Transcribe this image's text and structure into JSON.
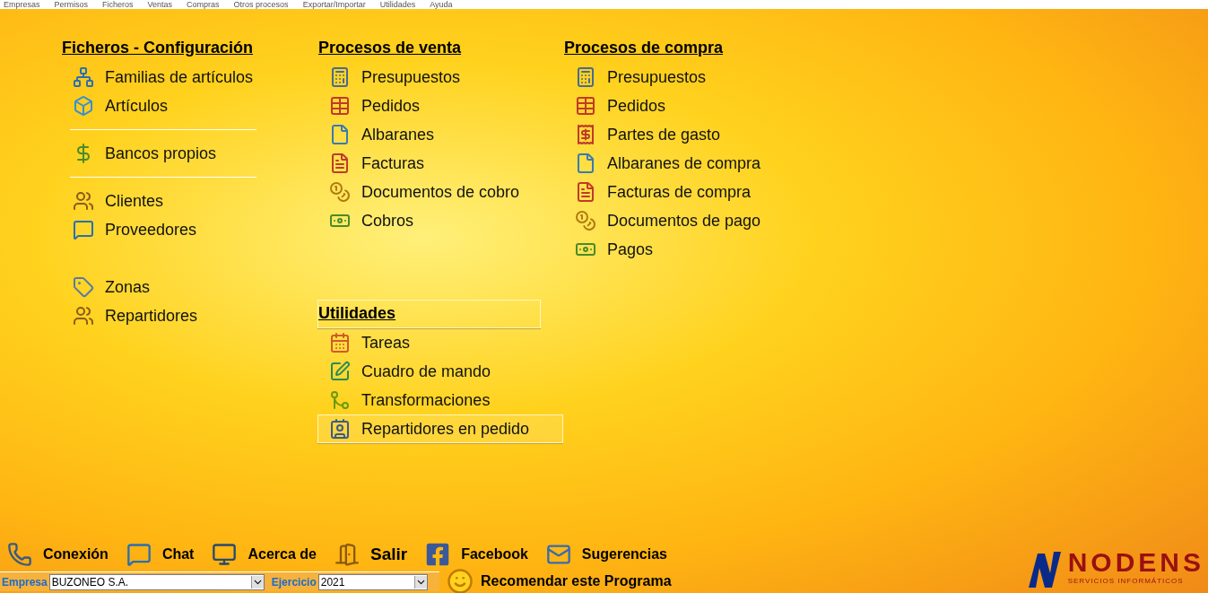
{
  "menu_bar": [
    "Empresas",
    "Permisos",
    "Ficheros",
    "Ventas",
    "Compras",
    "Otros procesos",
    "Exportar/Importar",
    "Utilidades",
    "Ayuda"
  ],
  "columns": [
    {
      "sections": [
        {
          "title": "Ficheros - Configuración",
          "highlighted": false,
          "groups": [
            {
              "kind": "plain",
              "items": [
                {
                  "label": "Familias de artículos",
                  "kind": "tree",
                  "hovered": false
                },
                {
                  "label": "Artículos",
                  "kind": "box",
                  "hovered": false
                }
              ]
            },
            {
              "kind": "divided",
              "items": [
                {
                  "label": "Bancos propios",
                  "kind": "dollar",
                  "hovered": false
                }
              ]
            },
            {
              "kind": "divided",
              "items": [
                {
                  "label": "Clientes",
                  "kind": "people",
                  "hovered": false
                },
                {
                  "label": "Proveedores",
                  "kind": "chat",
                  "hovered": false
                }
              ]
            },
            {
              "kind": "spaced",
              "items": [
                {
                  "label": "Zonas",
                  "kind": "tag",
                  "hovered": false
                },
                {
                  "label": "Repartidores",
                  "kind": "people",
                  "hovered": false
                }
              ]
            }
          ]
        }
      ]
    },
    {
      "sections": [
        {
          "title": "Procesos de venta",
          "highlighted": false,
          "groups": [
            {
              "kind": "plain",
              "items": [
                {
                  "label": "Presupuestos",
                  "kind": "calc",
                  "hovered": false
                },
                {
                  "label": "Pedidos",
                  "kind": "table",
                  "hovered": false
                },
                {
                  "label": "Albaranes",
                  "kind": "doc",
                  "hovered": false
                },
                {
                  "label": "Facturas",
                  "kind": "invoice",
                  "hovered": false
                },
                {
                  "label": "Documentos de cobro",
                  "kind": "coins",
                  "hovered": false
                },
                {
                  "label": "Cobros",
                  "kind": "cash",
                  "hovered": false
                }
              ]
            }
          ]
        },
        {
          "title": "Utilidades",
          "highlighted": true,
          "groups": [
            {
              "kind": "plain",
              "items": [
                {
                  "label": "Tareas",
                  "kind": "calendar",
                  "hovered": false
                },
                {
                  "label": "Cuadro de mando",
                  "kind": "edit",
                  "hovered": false
                },
                {
                  "label": "Transformaciones",
                  "kind": "merge",
                  "hovered": false
                },
                {
                  "label": "Repartidores en pedido",
                  "kind": "card",
                  "hovered": true
                }
              ]
            }
          ]
        }
      ]
    },
    {
      "sections": [
        {
          "title": "Procesos de compra",
          "highlighted": false,
          "groups": [
            {
              "kind": "plain",
              "items": [
                {
                  "label": "Presupuestos",
                  "kind": "calc",
                  "hovered": false
                },
                {
                  "label": "Pedidos",
                  "kind": "table",
                  "hovered": false
                },
                {
                  "label": "Partes de gasto",
                  "kind": "receipt",
                  "hovered": false
                },
                {
                  "label": "Albaranes de compra",
                  "kind": "doc",
                  "hovered": false
                },
                {
                  "label": "Facturas de compra",
                  "kind": "invoice",
                  "hovered": false
                },
                {
                  "label": "Documentos de pago",
                  "kind": "coins",
                  "hovered": false
                },
                {
                  "label": "Pagos",
                  "kind": "cash",
                  "hovered": false
                }
              ]
            }
          ]
        }
      ]
    }
  ],
  "toolbar": [
    {
      "label": "Conexión",
      "kind": "phone",
      "emphasis": false
    },
    {
      "label": "Chat",
      "kind": "chat",
      "emphasis": false
    },
    {
      "label": "Acerca de",
      "kind": "monitor",
      "emphasis": false
    },
    {
      "label": "Salir",
      "kind": "door",
      "emphasis": true
    },
    {
      "label": "Facebook",
      "kind": "facebook",
      "emphasis": false
    },
    {
      "label": "Sugerencias",
      "kind": "mail",
      "emphasis": false
    }
  ],
  "company": {
    "label": "Empresa",
    "value": "BUZONEO S.A."
  },
  "year": {
    "label": "Ejercicio",
    "value": "2021"
  },
  "recommend": {
    "label": "Recomendar este Programa"
  },
  "logo": {
    "name": "NODENS",
    "tagline": "SERVICIOS INFORMÁTICOS"
  }
}
